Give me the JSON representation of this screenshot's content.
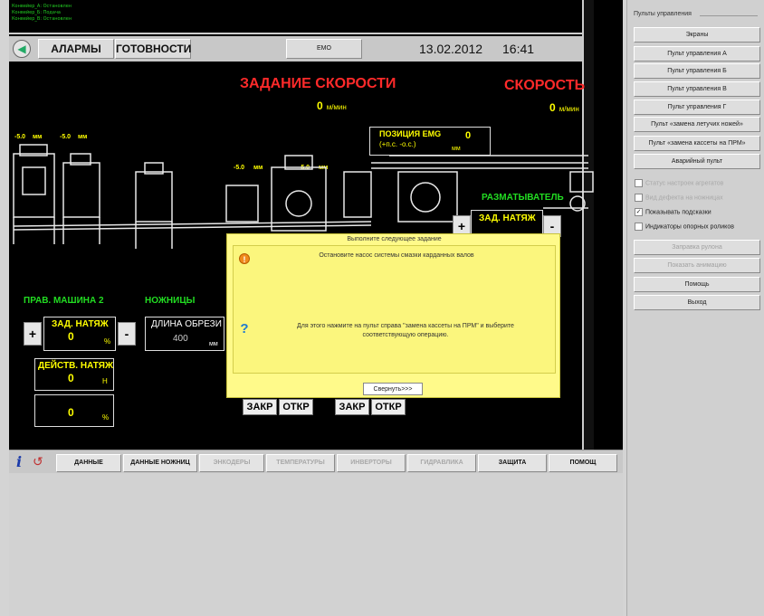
{
  "header": {
    "log_lines": [
      "Конвейер_А: Остановлен",
      "Конвейер_Б: Подача",
      "Конвейер_В: Остановлен"
    ],
    "alarms_label": "АЛАРМЫ",
    "readiness_label": "ГОТОВНОСТИ",
    "emo_label": "EMO",
    "date": "13.02.2012",
    "time": "16:41"
  },
  "speed_setpoint": {
    "title": "ЗАДАНИЕ СКОРОСТИ",
    "value": "0",
    "unit": "м/мин"
  },
  "speed": {
    "title": "СКОРОСТЬ",
    "value": "0",
    "unit": "м/мин"
  },
  "emg_position": {
    "label": "ПОЗИЦИЯ EMG",
    "sub": "(+п.с. -о.с.)",
    "value": "0",
    "unit": "мм"
  },
  "tiny_labels": [
    "-5.0",
    "мм",
    "-5.0",
    "мм",
    "-5.0",
    "мм",
    "-5.0",
    "мм"
  ],
  "unwinder": {
    "title": "РАЗМАТЫВАТЕЛЬ",
    "tension_label": "ЗАД. НАТЯЖ",
    "plus": "+",
    "minus": "-"
  },
  "leveler": {
    "title": "ПРАВ. МАШИНА 2",
    "tension_label": "ЗАД. НАТЯЖ",
    "tension_value": "0",
    "tension_unit": "%",
    "plus": "+",
    "minus": "-"
  },
  "actual_tension": {
    "label": "ДЕЙСТВ. НАТЯЖ",
    "value": "0",
    "unit": "Н"
  },
  "percent_box": {
    "value": "0",
    "unit": "%"
  },
  "shears": {
    "title": "НОЖНИЦЫ",
    "cut_length_label": "ДЛИНА ОБРЕЗИ",
    "cut_length_value": "400",
    "unit": "мм"
  },
  "valves": {
    "close1": "ЗАКР",
    "open1": "ОТКР",
    "close2": "ЗАКР",
    "open2": "ОТКР"
  },
  "dialog": {
    "title": "Выполните следующее задание",
    "warning_text": "Остановите насос системы смазки карданных валов",
    "help_text": "Для этого нажмите на пульт справа \"замена кассеты на ПРМ\" и выберите соответствующую операцию.",
    "collapse_button": "Свернуть>>>"
  },
  "bottom_bar": {
    "buttons": [
      {
        "label": "ДАННЫЕ",
        "enabled": true
      },
      {
        "label": "ДАННЫЕ НОЖНИЦ",
        "enabled": true
      },
      {
        "label": "ЭНКОДЕРЫ",
        "enabled": false
      },
      {
        "label": "ТЕМПЕРАТУРЫ",
        "enabled": false
      },
      {
        "label": "ИНВЕРТОРЫ",
        "enabled": false
      },
      {
        "label": "ГИДРАВЛИКА",
        "enabled": false
      },
      {
        "label": "ЗАЩИТА",
        "enabled": true
      },
      {
        "label": "ПОМОЩ",
        "enabled": true
      }
    ]
  },
  "right_panel": {
    "group_title": "Пульты управления",
    "buttons": [
      "Экраны",
      "Пульт управления А",
      "Пульт управления Б",
      "Пульт управления В",
      "Пульт управления Г",
      "Пульт «замена летучих ножей»",
      "Пульт «замена кассеты на ПРМ»",
      "Аварийный пульт"
    ],
    "checkboxes": [
      {
        "label": "Статус настроек агрегатов",
        "checked": false,
        "enabled": false
      },
      {
        "label": "Вид дефекта на ножницах",
        "checked": false,
        "enabled": false
      },
      {
        "label": "Показывать подсказки",
        "checked": true,
        "enabled": true
      },
      {
        "label": "Индикаторы опорных роликов",
        "checked": false,
        "enabled": true
      }
    ],
    "disabled_buttons": [
      "Заправка рулона",
      "Показать анимацию"
    ],
    "help": "Помощь",
    "exit": "Выход"
  },
  "colors": {
    "hmi_bg": "#000000",
    "title_red": "#ff2a2a",
    "value_yellow": "#ffff00",
    "label_green": "#22dd22",
    "dialog_bg": "#fffa8a"
  }
}
